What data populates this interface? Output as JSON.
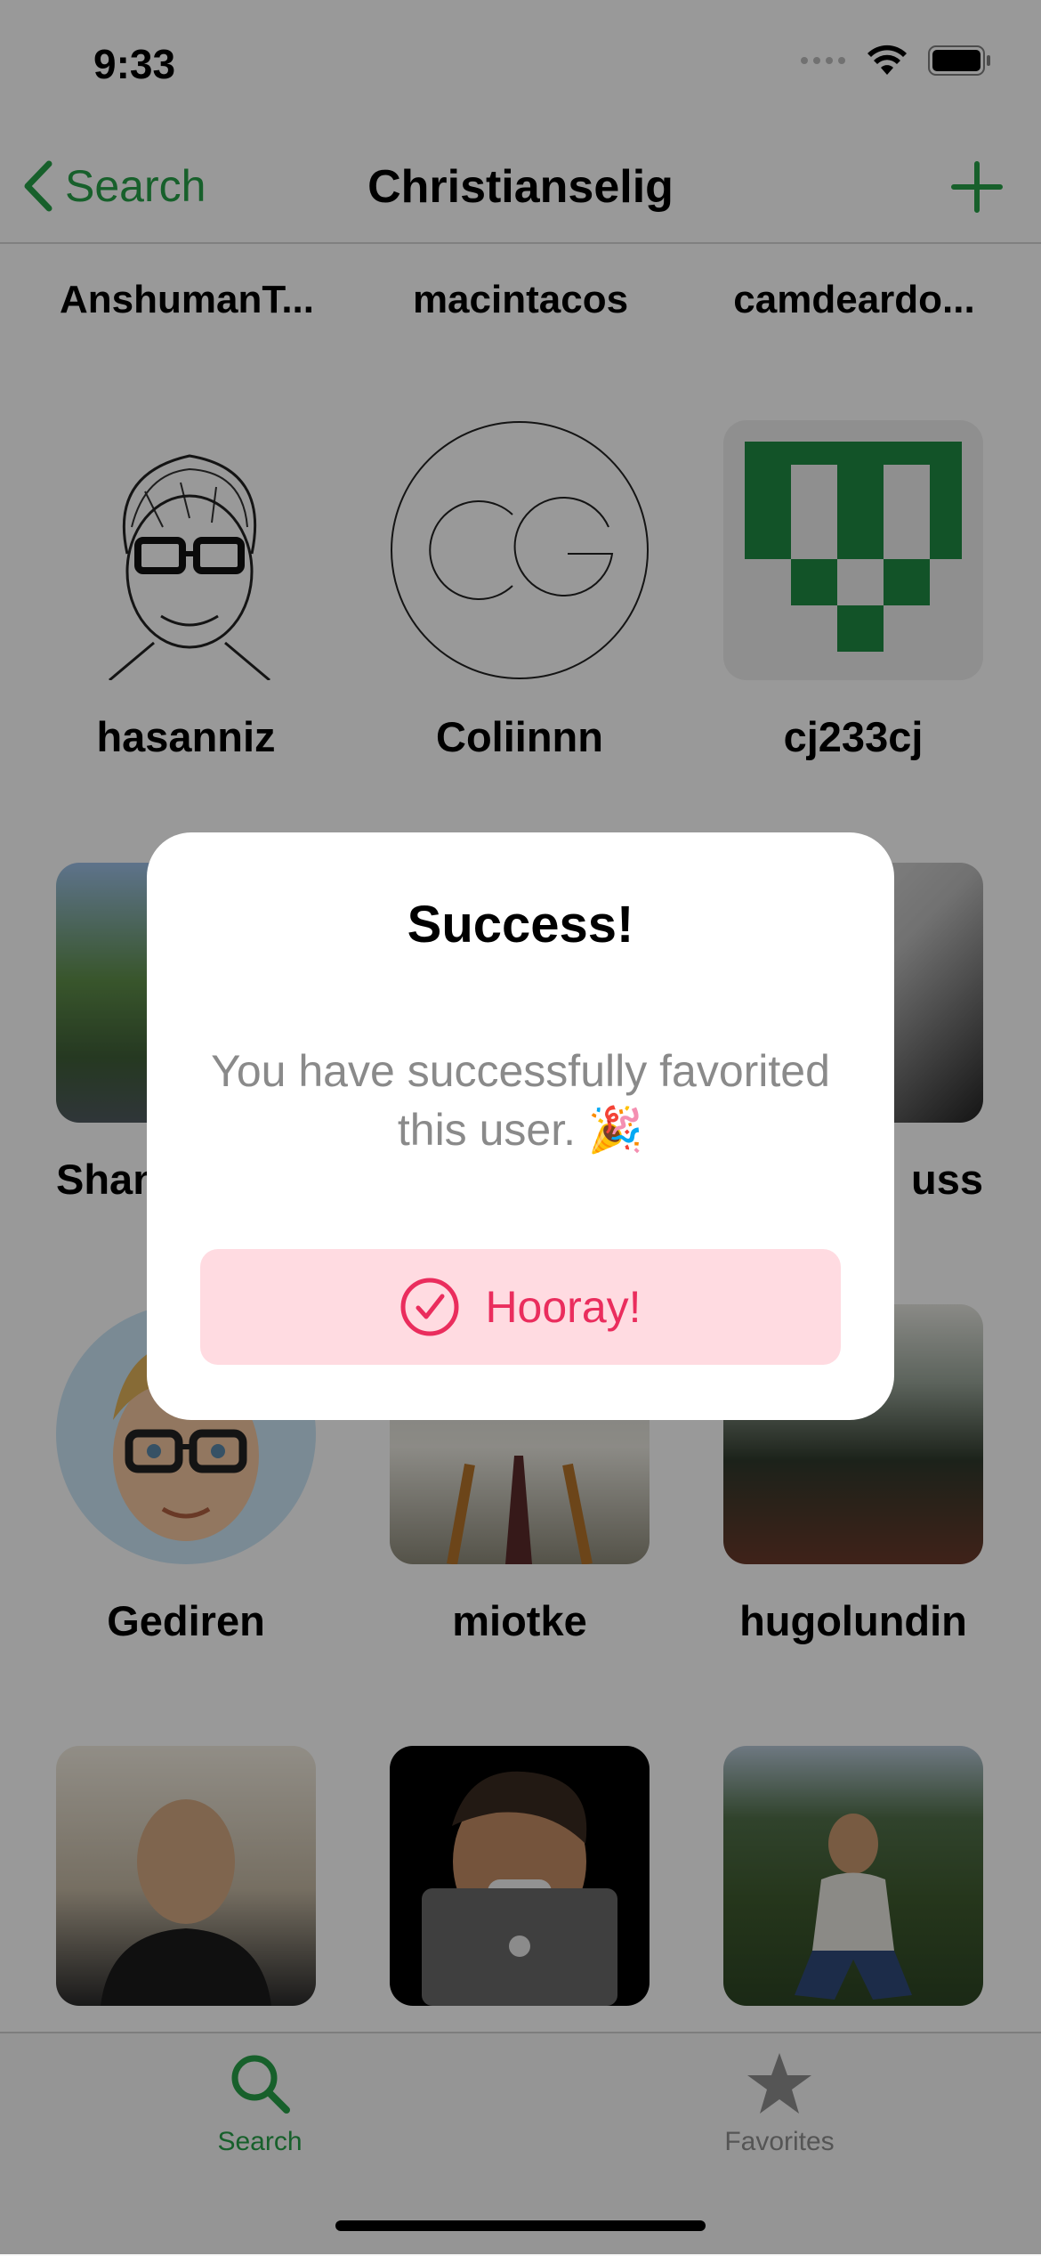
{
  "status": {
    "time": "9:33"
  },
  "nav": {
    "back_label": "Search",
    "title": "Christianselig"
  },
  "top_row": [
    "AnshumanT...",
    "macintacos",
    "camdeardo..."
  ],
  "grid_users": [
    {
      "name": "hasanniz",
      "avatar": "sketch-portrait"
    },
    {
      "name": "Coliinnn",
      "avatar": "cg-monogram"
    },
    {
      "name": "cj233cj",
      "avatar": "green-identicon"
    },
    {
      "name": "Shan",
      "avatar": "park-photo"
    },
    {
      "name": "",
      "avatar": "photo"
    },
    {
      "name": "uss",
      "avatar": "bw-portrait"
    },
    {
      "name": "Gediren",
      "avatar": "memoji"
    },
    {
      "name": "miotke",
      "avatar": "portrait-photo"
    },
    {
      "name": "hugolundin",
      "avatar": "outdoor-photo"
    },
    {
      "name": "",
      "avatar": "sunset-portrait"
    },
    {
      "name": "",
      "avatar": "memoji-laptop"
    },
    {
      "name": "",
      "avatar": "forest-photo"
    }
  ],
  "tabs": [
    {
      "label": "Search",
      "icon": "search-icon",
      "active": true
    },
    {
      "label": "Favorites",
      "icon": "star-icon",
      "active": false
    }
  ],
  "alert": {
    "title": "Success!",
    "message": "You have successfully favorited this user. 🎉",
    "button_label": "Hooray!"
  },
  "colors": {
    "accent": "#27a148",
    "alert_button_bg": "#ffdbe1",
    "alert_button_text": "#ea2d5d"
  }
}
